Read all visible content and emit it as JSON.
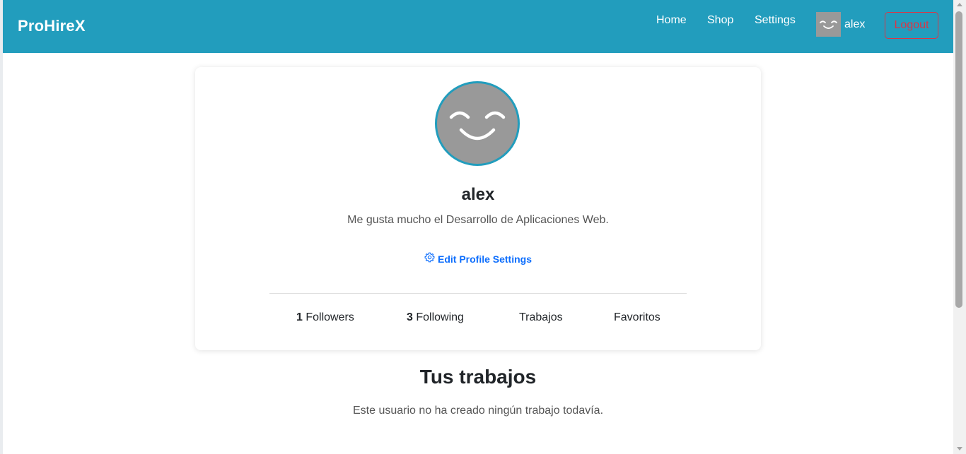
{
  "navbar": {
    "brand": "ProHireX",
    "links": {
      "home": "Home",
      "shop": "Shop",
      "settings": "Settings"
    },
    "user": {
      "name": "alex",
      "avatar_icon": "smiley-face-icon"
    },
    "logout_label": "Logout",
    "bg_color": "#229dbd",
    "logout_color": "#dc3545"
  },
  "profile": {
    "avatar_icon": "smiley-face-icon",
    "name": "alex",
    "bio": "Me gusta mucho el Desarrollo de Aplicaciones Web.",
    "edit_icon": "gear-icon",
    "edit_label": "Edit Profile Settings",
    "stats": {
      "followers_count": "1",
      "followers_label": "Followers",
      "following_count": "3",
      "following_label": "Following",
      "trabajos_label": "Trabajos",
      "favoritos_label": "Favoritos"
    }
  },
  "works_section": {
    "title": "Tus trabajos",
    "empty_message": "Este usuario no ha creado ningún trabajo todavía."
  }
}
